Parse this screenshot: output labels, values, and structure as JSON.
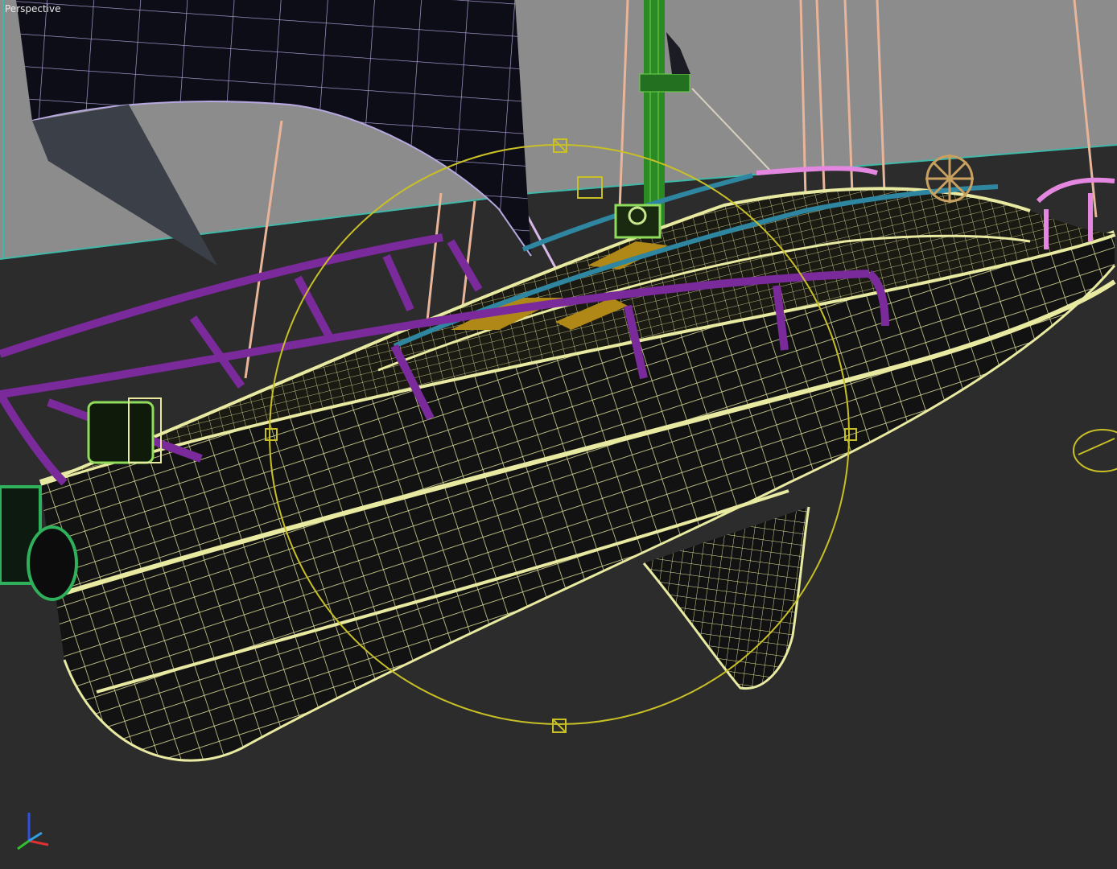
{
  "viewport": {
    "label": "Perspective"
  },
  "colors": {
    "background_upper": "#8c8c8c",
    "background_lower": "#2c2c2c",
    "horizon_line": "#3fb8a8",
    "hull_wire": "#e9eaa2",
    "hull_fill": "#121212",
    "railing": "#7b2a9c",
    "toe_rail": "#2e86a0",
    "mast": "#2c8a24",
    "rigging": "#e8b49a",
    "pulpit": "#e487e0",
    "sail_fill": "#0d0d18",
    "sail_wire": "#b8a8e0",
    "gizmo": "#c8c026",
    "hatch": "#b08818"
  },
  "icons": [
    "axis-tripod-icon",
    "selection-bracket-icon"
  ]
}
